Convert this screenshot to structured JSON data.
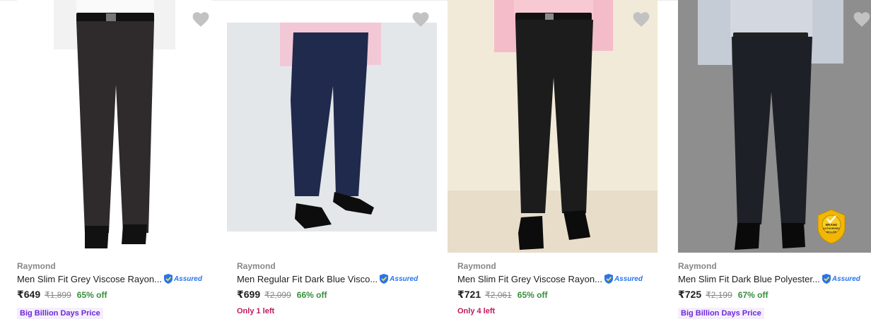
{
  "products": [
    {
      "brand": "Raymond",
      "title": "Men Slim Fit Grey Viscose Rayon...",
      "assured_label": "Assured",
      "price": "₹649",
      "mrp": "₹1,899",
      "discount": "65% off",
      "extra": "Big Billion Days Price",
      "extra_type": "badge",
      "image_bg": "#ffffff",
      "pants_color": "#2f2a2b",
      "shirt_color": "#ffffff"
    },
    {
      "brand": "Raymond",
      "title": "Men Regular Fit Dark Blue Visco...",
      "assured_label": "Assured",
      "price": "₹699",
      "mrp": "₹2,099",
      "discount": "66% off",
      "extra": "Only 1 left",
      "extra_type": "stock",
      "image_bg": "#e4e7ea",
      "pants_color": "#1f2a4d",
      "shirt_color": "#f3c8d6"
    },
    {
      "brand": "Raymond",
      "title": "Men Slim Fit Grey Viscose Rayon...",
      "assured_label": "Assured",
      "price": "₹721",
      "mrp": "₹2,061",
      "discount": "65% off",
      "extra": "Only 4 left",
      "extra_type": "stock",
      "image_bg": "#f1ead8",
      "pants_color": "#1c1c1c",
      "shirt_color": "#f4bcc8"
    },
    {
      "brand": "Raymond",
      "title": "Men Slim Fit Dark Blue Polyester...",
      "assured_label": "Assured",
      "price": "₹725",
      "mrp": "₹2,199",
      "discount": "67% off",
      "extra": "Big Billion Days Price",
      "extra_type": "badge",
      "image_bg": "#8e8e8e",
      "pants_color": "#1d2026",
      "shirt_color": "#c6ccd6",
      "seal_text": "BRAND AUTHORISED SELLER"
    }
  ],
  "colors": {
    "heart": "#c2c2c2",
    "accent": "#2874f0",
    "discount": "#388e3c",
    "badge_text": "#6d2bd3",
    "stock_text": "#c2185b"
  }
}
